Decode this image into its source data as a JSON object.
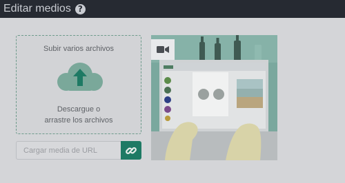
{
  "header": {
    "title": "Editar medios",
    "help_icon": "question-circle-icon"
  },
  "upload": {
    "title": "Subir varios archivos",
    "icon": "cloud-upload-icon",
    "desc_line1": "Descargue o",
    "desc_line2": "arrastre los archivos"
  },
  "url": {
    "placeholder": "Cargar media de URL",
    "button_icon": "link-icon"
  },
  "media": {
    "badge_icon": "video-camera-icon"
  },
  "colors": {
    "accent": "#1e7a64",
    "header_bg": "#262a32",
    "cloud": "#7aa89a"
  }
}
